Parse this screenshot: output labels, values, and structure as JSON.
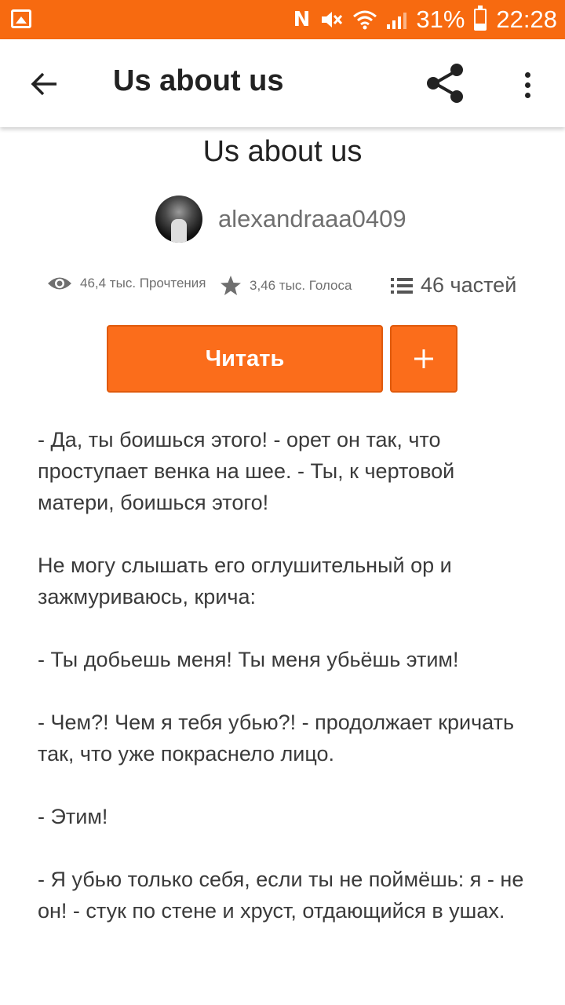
{
  "status_bar": {
    "battery": "31%",
    "time": "22:28",
    "icons": [
      "gallery-icon",
      "nfc-icon",
      "mute-icon",
      "wifi-icon",
      "signal-icon",
      "battery-icon"
    ]
  },
  "app_bar": {
    "title": "Us about us",
    "icons": [
      "back-arrow-icon",
      "share-icon",
      "more-vert-icon"
    ]
  },
  "story": {
    "title": "Us about us",
    "author": "alexandraaa0409",
    "stats": {
      "reads": "46,4 тыс. Прочтения",
      "votes": "3,46 тыс. Голоса",
      "parts": "46 частей"
    },
    "read_button": "Читать",
    "add_button_icon": "plus-icon"
  },
  "excerpt": [
    "- Да, ты боишься этого! - орет он так, что проступает венка на шее. - Ты, к чертовой матери, боишься этого!",
    "Не могу слышать его оглушительный ор и зажмуриваюсь, крича:",
    "- Ты добьешь меня! Ты меня убьёшь этим!",
    "- Чем?! Чем я тебя убью?! - продолжает кричать так, что уже покраснело лицо.",
    "- Этим!",
    "- Я убью только себя, если ты не поймёшь: я - не он! - стук по стене и хруст, отдающийся в ушах."
  ],
  "colors": {
    "accent": "#fb6d1b",
    "status_bar": "#f76a10"
  }
}
